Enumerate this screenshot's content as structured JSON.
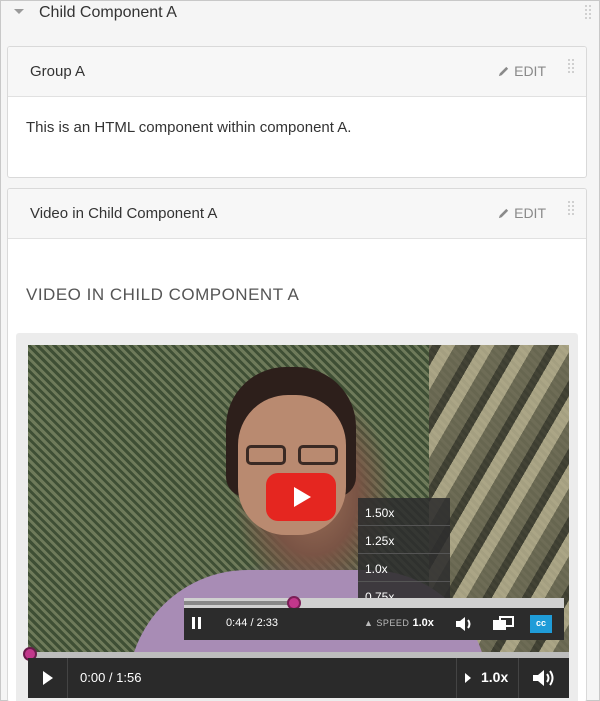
{
  "header": {
    "title": "Child Component A",
    "caret_icon": "caret-down-icon",
    "grip_icon": "drag-handle-icon"
  },
  "panels": [
    {
      "title": "Group A",
      "edit_label": "EDIT",
      "edit_icon": "pencil-icon",
      "body_text": "This is an HTML component within component A."
    },
    {
      "title": "Video in Child Component A",
      "edit_label": "EDIT",
      "edit_icon": "pencil-icon",
      "heading": "VIDEO IN CHILD COMPONENT A"
    }
  ],
  "video": {
    "speed_options": [
      "1.50x",
      "1.25x",
      "1.0x",
      "0.75x"
    ],
    "inner_player": {
      "time": "0:44 / 2:33",
      "speed_label": "SPEED",
      "speed_value": "1.0x",
      "cc_label": "cc",
      "progress": 0.29
    },
    "outer_player": {
      "time": "0:00 / 1:56",
      "speed_value": "1.0x",
      "progress": 0.0
    }
  },
  "colors": {
    "accent_pink": "#c1378b",
    "play_red": "#e52620",
    "cc_blue": "#1f9cd8"
  }
}
